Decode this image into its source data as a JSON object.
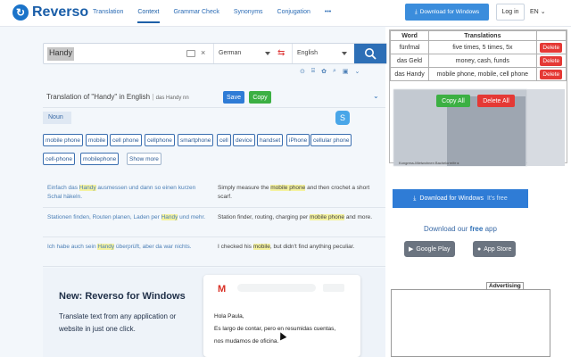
{
  "header": {
    "logo_text": "Reverso",
    "nav": [
      "Translation",
      "Context",
      "Grammar Check",
      "Synonyms",
      "Conjugation",
      "•••"
    ],
    "download_label": "Download for Windows",
    "login_label": "Log in",
    "lang_label": "EN"
  },
  "search": {
    "query": "Handy",
    "source_lang": "German",
    "target_lang": "English",
    "tools": [
      "⊙",
      "⌸",
      "✿",
      "⌕",
      "▣",
      "⌄"
    ]
  },
  "translation": {
    "title": "Translation of \"Handy\" in English",
    "sub": "das Handy nn",
    "save_label": "Save",
    "copy_label": "Copy",
    "pos": "Noun",
    "s_badge": "S",
    "chips": [
      "mobile phone",
      "mobile",
      "cell phone",
      "cellphone",
      "smartphone",
      "cell",
      "device",
      "handset",
      "iPhone",
      "cellular phone",
      "cell-phone",
      "mobilephone",
      "Show more"
    ]
  },
  "examples": [
    {
      "src_pre": "Einfach das ",
      "src_hl": "Handy",
      "src_post": " ausmessen und dann so einen kurzen Schal häkeln.",
      "tgt_pre": "Simply measure the ",
      "tgt_hl": "mobile phone",
      "tgt_post": " and then crochet a short scarf."
    },
    {
      "src_pre": "Stationen finden, Routen planen, Laden per ",
      "src_hl": "Handy",
      "src_post": " und mehr.",
      "tgt_pre": "Station finder, routing, charging per ",
      "tgt_hl": "mobile phone",
      "tgt_post": " and more."
    },
    {
      "src_pre": "Ich habe auch sein ",
      "src_hl": "Handy",
      "src_post": " überprüft, aber da war nichts.",
      "tgt_pre": "I checked his ",
      "tgt_hl": "mobile",
      "tgt_post": ", but didn't find anything peculiar."
    }
  ],
  "promo": {
    "title": "New: Reverso for Windows",
    "desc": "Translate text from any application or website in just one click.",
    "mail_logo": "M",
    "mail_greeting": "Hola Paula,",
    "mail_line1": "Es largo de contar, pero en resumidas cuentas,",
    "mail_line2": "nos mudamos de oficina."
  },
  "overlay": {
    "headers": [
      "Word",
      "Translations"
    ],
    "rows": [
      {
        "word": "fünfmal",
        "translations": "five times, 5 times, 5x",
        "delete": "Delete"
      },
      {
        "word": "das Geld",
        "translations": "money, cash, funds",
        "delete": "Delete"
      },
      {
        "word": "das Handy",
        "translations": "mobile phone, mobile, cell phone",
        "delete": "Delete"
      }
    ],
    "copy_all": "Copy All",
    "delete_all": "Delete All",
    "caption": "Kongress-Mietwohnen    Bachelorreife ▸"
  },
  "sidebar": {
    "download_label": "Download for Windows",
    "download_suffix": "It's free",
    "app_prefix": "Download our",
    "app_free": "free",
    "app_suffix": "app",
    "google_play": "Google Play",
    "app_store": "App Store",
    "advertising": "Advertising"
  },
  "colors": {
    "brand": "#1a5ea8",
    "accent": "#2f7cd6",
    "green": "#3cb043",
    "red": "#e53935"
  }
}
